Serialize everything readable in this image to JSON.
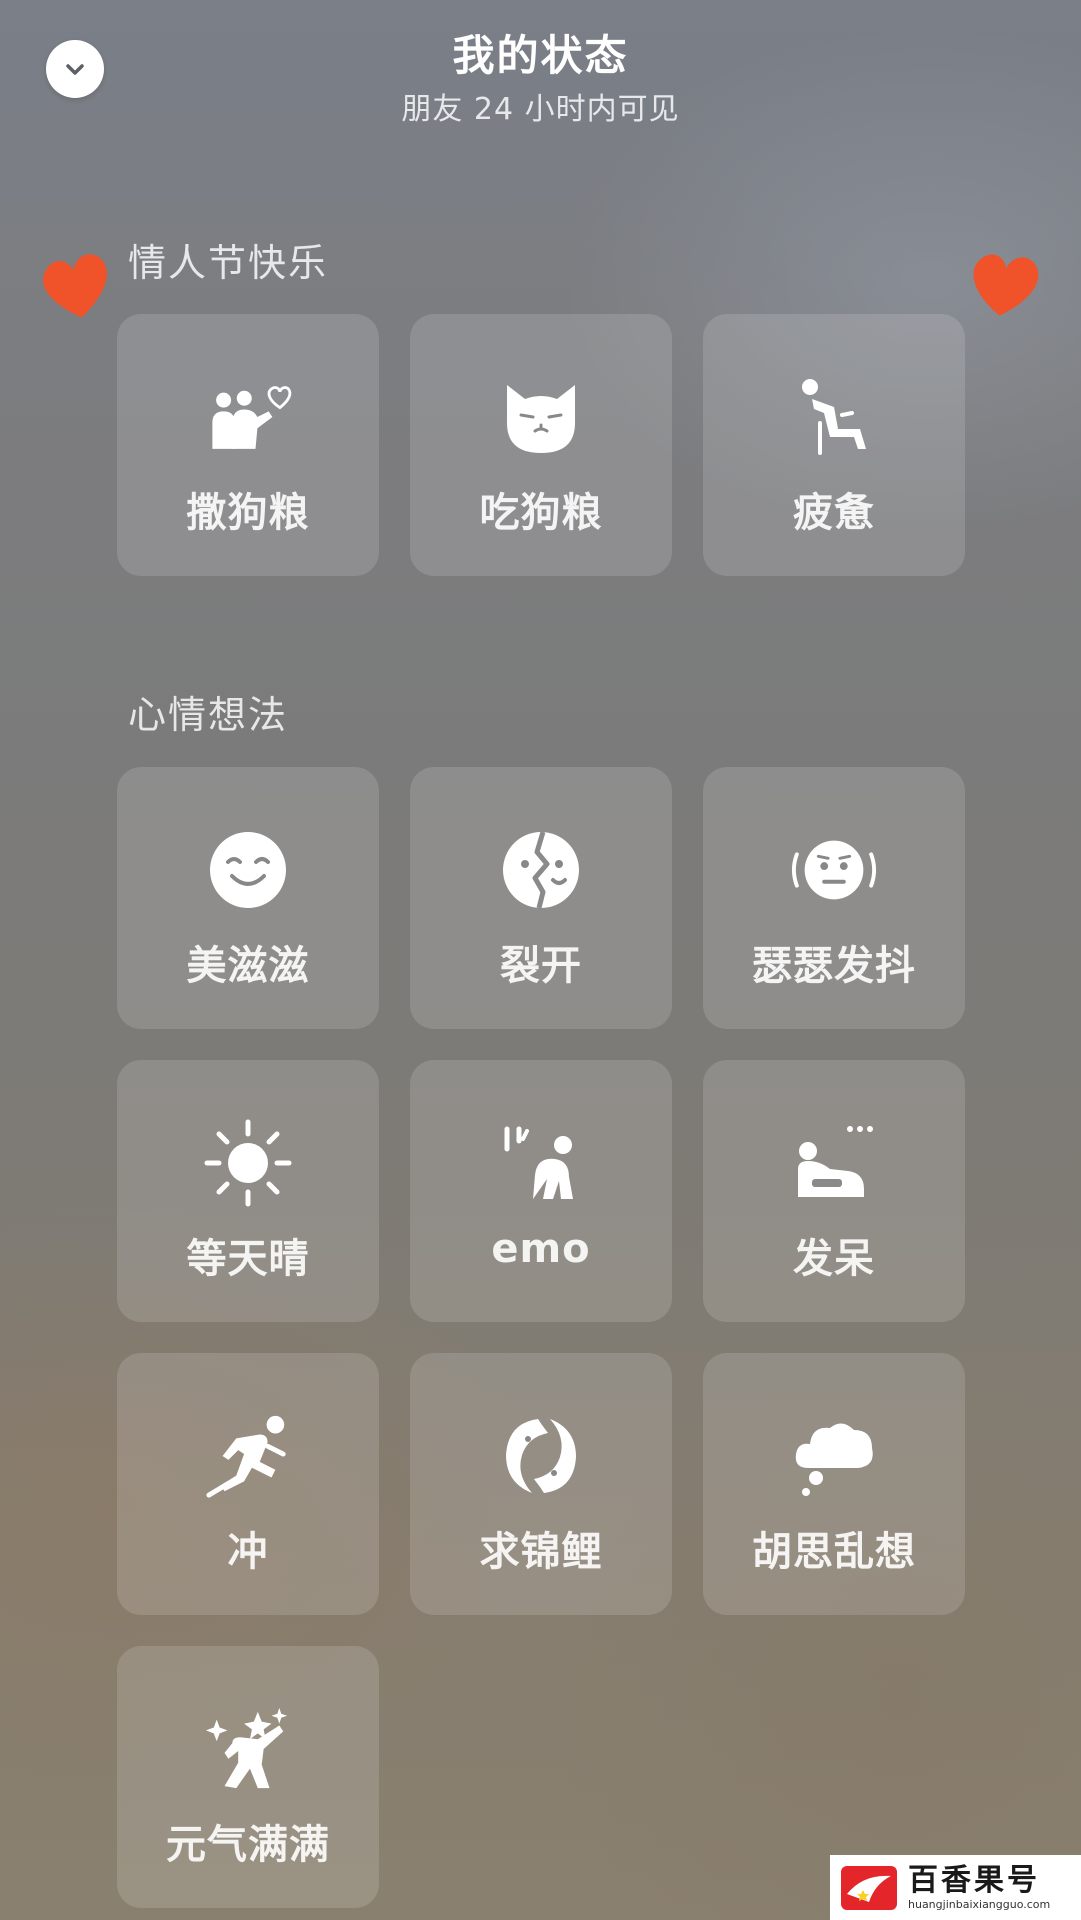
{
  "header": {
    "title": "我的状态",
    "subtitle": "朋友 24 小时内可见"
  },
  "sections": [
    {
      "title": "情人节快乐",
      "tiles": [
        {
          "label": "撒狗粮",
          "icon": "couple-heart-icon"
        },
        {
          "label": "吃狗粮",
          "icon": "cat-face-icon"
        },
        {
          "label": "疲惫",
          "icon": "tired-person-icon"
        }
      ]
    },
    {
      "title": "心情想法",
      "tiles": [
        {
          "label": "美滋滋",
          "icon": "smile-face-icon"
        },
        {
          "label": "裂开",
          "icon": "cracked-face-icon"
        },
        {
          "label": "瑟瑟发抖",
          "icon": "shivering-face-icon"
        },
        {
          "label": "等天晴",
          "icon": "sun-icon"
        },
        {
          "label": "emo",
          "icon": "emo-person-icon"
        },
        {
          "label": "发呆",
          "icon": "daze-person-icon"
        },
        {
          "label": "冲",
          "icon": "running-person-icon"
        },
        {
          "label": "求锦鲤",
          "icon": "koi-fish-icon"
        },
        {
          "label": "胡思乱想",
          "icon": "thought-cloud-icon"
        },
        {
          "label": "元气满满",
          "icon": "energetic-person-icon"
        }
      ]
    }
  ],
  "watermark": {
    "name": "百香果号",
    "url": "huangjinbaixiangguo.com"
  },
  "colors": {
    "heart": "#f0532a",
    "icon": "#ffffff"
  }
}
